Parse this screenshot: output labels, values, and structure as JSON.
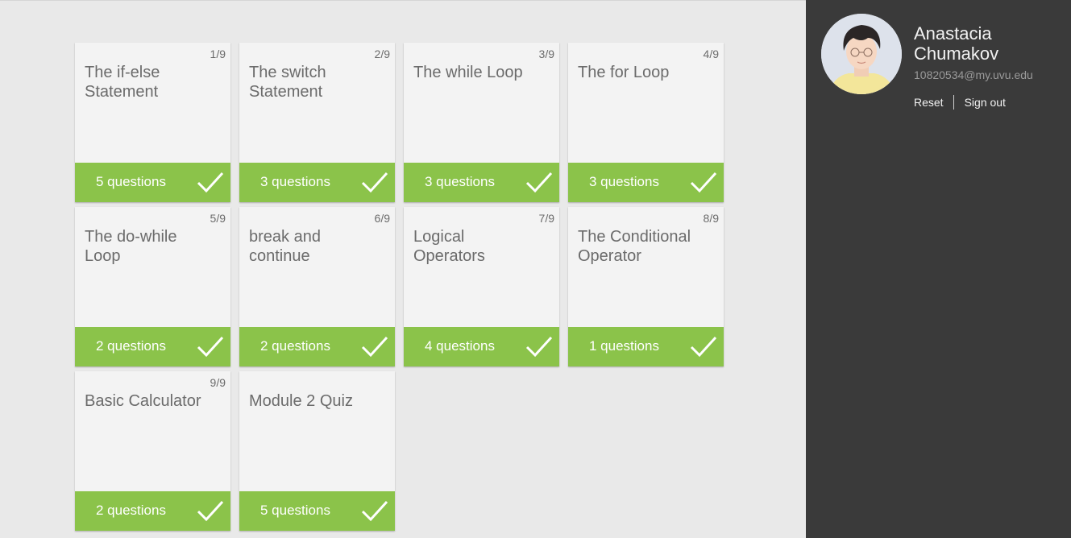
{
  "modules": [
    {
      "title": "The if-else Statement",
      "index": "1/9",
      "count": "5 questions",
      "status_icon": "check-icon"
    },
    {
      "title": "The switch Statement",
      "index": "2/9",
      "count": "3 questions",
      "status_icon": "check-icon"
    },
    {
      "title": "The while Loop",
      "index": "3/9",
      "count": "3 questions",
      "status_icon": "check-icon"
    },
    {
      "title": "The for Loop",
      "index": "4/9",
      "count": "3 questions",
      "status_icon": "check-icon"
    },
    {
      "title": "The do-while Loop",
      "index": "5/9",
      "count": "2 questions",
      "status_icon": "check-icon"
    },
    {
      "title": "break and continue",
      "index": "6/9",
      "count": "2 questions",
      "status_icon": "check-icon"
    },
    {
      "title": "Logical Operators",
      "index": "7/9",
      "count": "4 questions",
      "status_icon": "check-icon"
    },
    {
      "title": "The Conditional Operator",
      "index": "8/9",
      "count": "1 questions",
      "status_icon": "check-icon"
    },
    {
      "title": "Basic Calculator",
      "index": "9/9",
      "count": "2 questions",
      "status_icon": "check-icon"
    },
    {
      "title": "Module 2 Quiz",
      "index": "",
      "count": "5 questions",
      "status_icon": "check-icon"
    }
  ],
  "user": {
    "name": "Anastacia Chumakov",
    "email": "10820534@my.uvu.edu",
    "avatar_icon": "avatar-illustration"
  },
  "actions": {
    "reset_label": "Reset",
    "signout_label": "Sign out"
  },
  "colors": {
    "complete_green": "#8bc34a",
    "sidebar_bg": "#3a3a3a",
    "card_bg": "#f3f3f3"
  }
}
